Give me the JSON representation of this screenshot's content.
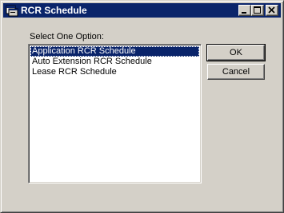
{
  "window": {
    "title": "RCR Schedule",
    "controls": {
      "minimize": "minimize",
      "maximize": "maximize",
      "close": "close"
    }
  },
  "dialog": {
    "prompt": "Select One Option:",
    "options": [
      {
        "label": "Application RCR Schedule",
        "selected": true
      },
      {
        "label": "Auto Extension RCR Schedule",
        "selected": false
      },
      {
        "label": "Lease RCR Schedule",
        "selected": false
      }
    ],
    "ok_label": "OK",
    "cancel_label": "Cancel"
  },
  "colors": {
    "titlebar": "#0a246a",
    "face": "#d4d0c8",
    "selection": "#0a246a"
  },
  "icons": [
    "app-window-icon",
    "minimize-icon",
    "maximize-icon",
    "close-icon"
  ]
}
